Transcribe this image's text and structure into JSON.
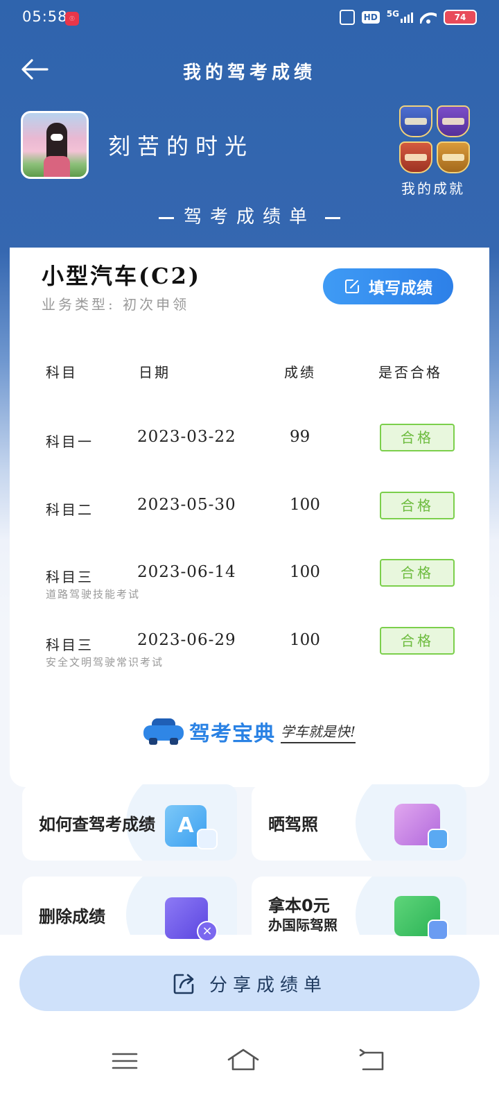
{
  "status_bar": {
    "time": "05:58",
    "network": "5G",
    "hd_label": "HD",
    "battery": "74"
  },
  "header": {
    "title": "我的驾考成绩"
  },
  "profile": {
    "username": "刻苦的时光",
    "achievements_label": "我的成就"
  },
  "report": {
    "heading": "驾考成绩单",
    "license_type": "小型汽车(C2)",
    "business_type": "业务类型: 初次申领",
    "fill_button": "填写成绩",
    "columns": [
      "科目",
      "日期",
      "成绩",
      "是否合格"
    ],
    "rows": [
      {
        "subject": "科目一",
        "note": "",
        "date": "2023-03-22",
        "score": "99",
        "status": "合格"
      },
      {
        "subject": "科目二",
        "note": "",
        "date": "2023-05-30",
        "score": "100",
        "status": "合格"
      },
      {
        "subject": "科目三",
        "note": "道路驾驶技能考试",
        "date": "2023-06-14",
        "score": "100",
        "status": "合格"
      },
      {
        "subject": "科目三",
        "note": "安全文明驾驶常识考试",
        "date": "2023-06-29",
        "score": "100",
        "status": "合格"
      }
    ],
    "brand_name": "驾考宝典",
    "brand_slogan": "学车就是快!"
  },
  "tiles": {
    "check_score": "如何查驾考成绩",
    "show_license": "晒驾照",
    "delete_score": "删除成绩",
    "intl_license_line1": "拿本0元",
    "intl_license_line2": "办国际驾照"
  },
  "share": {
    "label": "分享成绩单"
  },
  "colors": {
    "header_blue": "#2f64ad",
    "pass_green": "#6cbb3d",
    "accent_blue": "#2d80e8"
  }
}
